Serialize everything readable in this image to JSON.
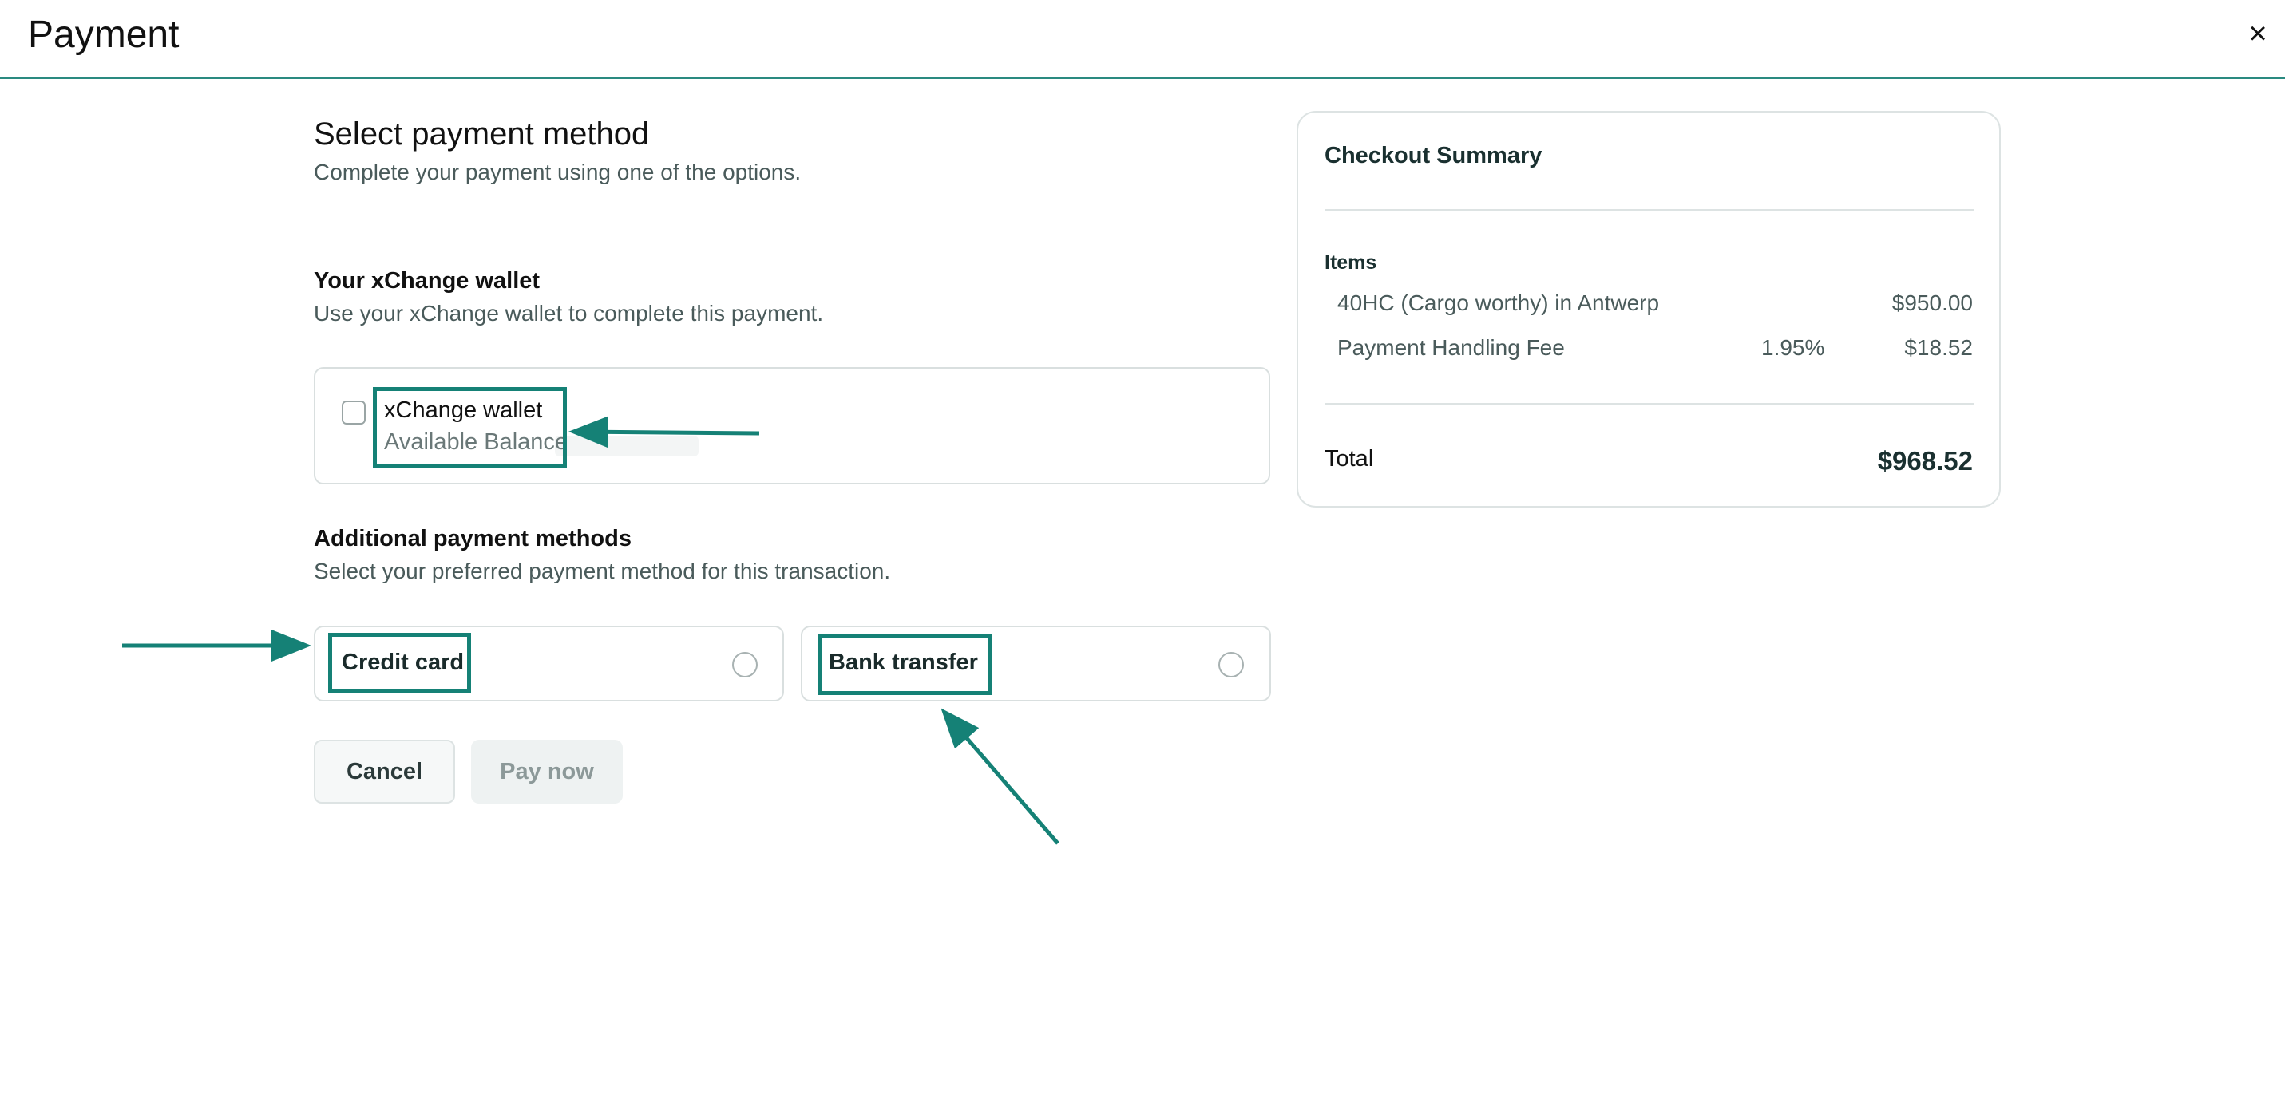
{
  "header": {
    "title": "Payment",
    "close_symbol": "×"
  },
  "main": {
    "title": "Select payment method",
    "subtitle": "Complete your payment using one of the options."
  },
  "wallet_section": {
    "title": "Your xChange wallet",
    "subtitle": "Use your xChange wallet to complete this payment.",
    "option_label": "xChange wallet",
    "balance_label": "Available Balance",
    "checked": false
  },
  "additional_section": {
    "title": "Additional payment methods",
    "subtitle": "Select your preferred payment method for this transaction.",
    "methods": [
      {
        "label": "Credit card",
        "selected": false
      },
      {
        "label": "Bank transfer",
        "selected": false
      }
    ]
  },
  "actions": {
    "cancel_label": "Cancel",
    "pay_label": "Pay now",
    "pay_disabled": true
  },
  "summary": {
    "title": "Checkout Summary",
    "items_label": "Items",
    "items": [
      {
        "name": "40HC (Cargo worthy) in Antwerp",
        "rate": "",
        "amount": "$950.00"
      },
      {
        "name": "Payment Handling Fee",
        "rate": "1.95%",
        "amount": "$18.52"
      }
    ],
    "total_label": "Total",
    "total_value": "$968.52"
  },
  "annotation_color": "#158176"
}
